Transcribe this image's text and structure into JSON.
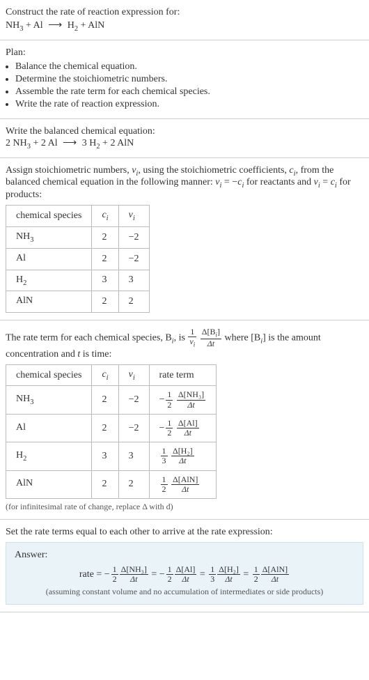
{
  "prompt": {
    "line1": "Construct the rate of reaction expression for:",
    "eq_lhs_1": "NH",
    "eq_lhs_1_sub": "3",
    "plus1": " + Al ",
    "arrow": "⟶",
    "eq_rhs_1": " H",
    "eq_rhs_1_sub": "2",
    "plus2": " + AlN"
  },
  "plan": {
    "header": "Plan:",
    "items": [
      "Balance the chemical equation.",
      "Determine the stoichiometric numbers.",
      "Assemble the rate term for each chemical species.",
      "Write the rate of reaction expression."
    ]
  },
  "balanced": {
    "header": "Write the balanced chemical equation:",
    "c1": "2 NH",
    "c1_sub": "3",
    "plus1": " + 2 Al ",
    "arrow": "⟶",
    "c2": " 3 H",
    "c2_sub": "2",
    "plus2": " + 2 AlN"
  },
  "assign": {
    "text1": "Assign stoichiometric numbers, ",
    "nu_i": "ν",
    "nu_i_sub": "i",
    "text2": ", using the stoichiometric coefficients, ",
    "c_i": "c",
    "c_i_sub": "i",
    "text3": ", from the balanced chemical equation in the following manner: ",
    "rel1a": "ν",
    "rel1a_sub": "i",
    "rel1b": " = −",
    "rel1c": "c",
    "rel1c_sub": "i",
    "text4": " for reactants and ",
    "rel2a": "ν",
    "rel2a_sub": "i",
    "rel2b": " = ",
    "rel2c": "c",
    "rel2c_sub": "i",
    "text5": " for products:"
  },
  "table1": {
    "h1": "chemical species",
    "h2": "c",
    "h2_sub": "i",
    "h3": "ν",
    "h3_sub": "i",
    "rows": [
      {
        "sp": "NH",
        "sp_sub": "3",
        "c": "2",
        "nu": "−2"
      },
      {
        "sp": "Al",
        "sp_sub": "",
        "c": "2",
        "nu": "−2"
      },
      {
        "sp": "H",
        "sp_sub": "2",
        "c": "3",
        "nu": "3"
      },
      {
        "sp": "AlN",
        "sp_sub": "",
        "c": "2",
        "nu": "2"
      }
    ]
  },
  "rateterm": {
    "text1": "The rate term for each chemical species, B",
    "sub_i": "i",
    "text2": ", is ",
    "frac1_num": "1",
    "frac1_den_a": "ν",
    "frac1_den_sub": "i",
    "frac2_num_a": "Δ[B",
    "frac2_num_sub": "i",
    "frac2_num_b": "]",
    "frac2_den": "Δt",
    "text3": " where [B",
    "text3_sub": "i",
    "text4": "] is the amount concentration and ",
    "t_var": "t",
    "text5": " is time:"
  },
  "table2": {
    "h1": "chemical species",
    "h2": "c",
    "h2_sub": "i",
    "h3": "ν",
    "h3_sub": "i",
    "h4": "rate term",
    "rows": [
      {
        "sp": "NH",
        "sp_sub": "3",
        "c": "2",
        "nu": "−2",
        "sign": "−",
        "fn": "1",
        "fd": "2",
        "num": "Δ[NH₃]",
        "den": "Δt"
      },
      {
        "sp": "Al",
        "sp_sub": "",
        "c": "2",
        "nu": "−2",
        "sign": "−",
        "fn": "1",
        "fd": "2",
        "num": "Δ[Al]",
        "den": "Δt"
      },
      {
        "sp": "H",
        "sp_sub": "2",
        "c": "3",
        "nu": "3",
        "sign": "",
        "fn": "1",
        "fd": "3",
        "num": "Δ[H₂]",
        "den": "Δt"
      },
      {
        "sp": "AlN",
        "sp_sub": "",
        "c": "2",
        "nu": "2",
        "sign": "",
        "fn": "1",
        "fd": "2",
        "num": "Δ[AlN]",
        "den": "Δt"
      }
    ],
    "note": "(for infinitesimal rate of change, replace Δ with d)"
  },
  "final": {
    "header": "Set the rate terms equal to each other to arrive at the rate expression:",
    "answer_label": "Answer:",
    "rate_label": "rate = ",
    "terms": [
      {
        "sign": "−",
        "fn": "1",
        "fd": "2",
        "num": "Δ[NH₃]",
        "den": "Δt"
      },
      {
        "sign": "−",
        "fn": "1",
        "fd": "2",
        "num": "Δ[Al]",
        "den": "Δt"
      },
      {
        "sign": "",
        "fn": "1",
        "fd": "3",
        "num": "Δ[H₂]",
        "den": "Δt"
      },
      {
        "sign": "",
        "fn": "1",
        "fd": "2",
        "num": "Δ[AlN]",
        "den": "Δt"
      }
    ],
    "eq": " = ",
    "note": "(assuming constant volume and no accumulation of intermediates or side products)"
  },
  "chart_data": {
    "type": "table",
    "title": "Stoichiometric coefficients and numbers",
    "columns": [
      "chemical species",
      "c_i",
      "ν_i"
    ],
    "rows": [
      [
        "NH3",
        2,
        -2
      ],
      [
        "Al",
        2,
        -2
      ],
      [
        "H2",
        3,
        3
      ],
      [
        "AlN",
        2,
        2
      ]
    ]
  }
}
